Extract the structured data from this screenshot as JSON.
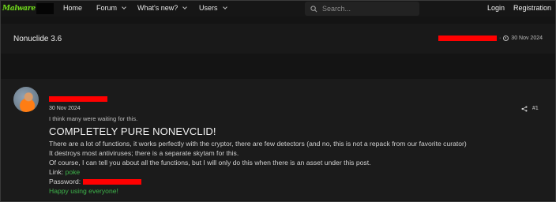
{
  "nav": {
    "logo_text": "Malware",
    "items": [
      {
        "label": "Home",
        "has_dropdown": false
      },
      {
        "label": "Forum",
        "has_dropdown": true
      },
      {
        "label": "What's new?",
        "has_dropdown": true
      },
      {
        "label": "Users",
        "has_dropdown": true
      }
    ],
    "search_placeholder": "Search...",
    "login_label": "Login",
    "register_label": "Registration"
  },
  "thread": {
    "title": "Nonuclide 3.6",
    "date": "30 Nov 2024",
    "separator": "·"
  },
  "post": {
    "date": "30 Nov 2024",
    "number": "#1",
    "intro": "I think many were waiting for this.",
    "headline": "COMPLETELY PURE NONEVCLID!",
    "line1": "There are a lot of functions, it works perfectly with the cryptor, there are few detectors (and no, this is not a repack from our favorite curator)",
    "line2": "It destroys most antiviruses; there is a separate skytam for this.",
    "line3": "Of course, I can tell you about all the functions, but I will only do this when there is an asset under this post.",
    "link_label": "Link:",
    "link_text": "poke",
    "password_label": "Password:",
    "closing": "Happy using everyone!"
  },
  "colors": {
    "accent_green": "#3db34a",
    "logo_green": "#6fd21f",
    "redaction": "#ff0000",
    "background": "#141414"
  },
  "icons": [
    "search-icon",
    "clock-icon",
    "share-icon",
    "chevron-down-icon"
  ]
}
